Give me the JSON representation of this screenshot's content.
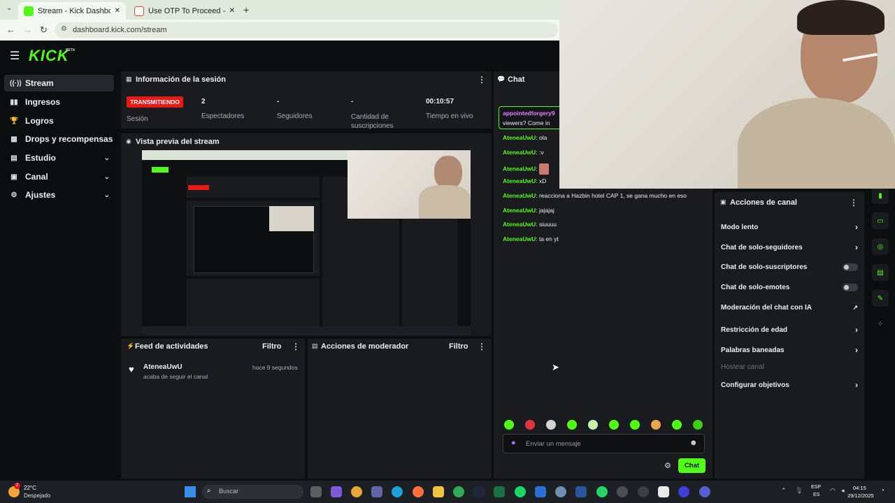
{
  "browser": {
    "tabs": [
      {
        "label": "Stream - Kick Dashboard",
        "active": true
      },
      {
        "label": "Use OTP To Proceed - elfacheer",
        "active": false
      }
    ],
    "url": "dashboard.kick.com/stream"
  },
  "brand": {
    "logo": "KICK",
    "badge": "BETA",
    "accent": "#53fc18"
  },
  "sidebar": {
    "items": [
      {
        "label": "Stream",
        "icon": "stream-icon",
        "active": true
      },
      {
        "label": "Ingresos",
        "icon": "revenue-icon"
      },
      {
        "label": "Logros",
        "icon": "trophy-icon"
      },
      {
        "label": "Drops y recompensas",
        "icon": "gift-icon"
      },
      {
        "label": "Estudio",
        "icon": "studio-icon",
        "expandable": true
      },
      {
        "label": "Canal",
        "icon": "channel-icon",
        "expandable": true
      },
      {
        "label": "Ajustes",
        "icon": "gear-icon",
        "expandable": true
      }
    ]
  },
  "session": {
    "title": "Información de la sesión",
    "status_badge": "TRANSMITIENDO",
    "status_label": "Sesión",
    "stats": [
      {
        "value": "2",
        "label": "Espectadores"
      },
      {
        "value": "-",
        "label": "Seguidores"
      },
      {
        "value": "-",
        "label": "Cantidad de suscripciones"
      },
      {
        "value": "00:10:57",
        "label": "Tiempo en vivo"
      }
    ]
  },
  "preview": {
    "title": "Vista previa del stream"
  },
  "activity": {
    "title": "Feed de actividades",
    "filter": "Filtro",
    "items": [
      {
        "user": "AteneaUwU",
        "text": "acaba de seguir el canal",
        "time": "hace 9 segundos"
      }
    ]
  },
  "moderator": {
    "title": "Acciones de moderador",
    "filter": "Filtro"
  },
  "chat": {
    "title": "Chat",
    "pinned": {
      "user": "appointedforgery9",
      "text": "viewers? Come in"
    },
    "messages": [
      {
        "user": "AteneaUwU",
        "text": "ola"
      },
      {
        "user": "AteneaUwU",
        "text": ":v"
      },
      {
        "user": "AteneaUwU",
        "text": ""
      },
      {
        "user": "AteneaUwU",
        "text": "xD"
      },
      {
        "user": "AteneaUwU",
        "text": "reacciona a Hazbin hotel CAP 1, se gana mucho en eso"
      },
      {
        "user": "AteneaUwU",
        "text": "jajajaj"
      },
      {
        "user": "AteneaUwU",
        "text": "siuuuu"
      },
      {
        "user": "AteneaUwU",
        "text": "ta en yt"
      }
    ],
    "input_placeholder": "Enviar un mensaje",
    "send_label": "Chat"
  },
  "channel_actions": {
    "title": "Acciones de canal",
    "items": [
      {
        "label": "Modo lento",
        "control": "arrow"
      },
      {
        "label": "Chat de solo-seguidores",
        "control": "arrow"
      },
      {
        "label": "Chat de solo-suscriptores",
        "control": "toggle",
        "on": false
      },
      {
        "label": "Chat de solo-emotes",
        "control": "toggle",
        "on": false
      },
      {
        "label": "Moderación del chat con IA",
        "control": "external"
      },
      {
        "label": "Restricción de edad",
        "control": "arrow"
      },
      {
        "label": "Palabras baneadas",
        "control": "arrow"
      },
      {
        "label": "Hostear canal",
        "control": "none",
        "disabled": true
      },
      {
        "label": "Configurar objetivos",
        "control": "arrow"
      }
    ]
  },
  "taskbar": {
    "weather_temp": "22°C",
    "weather_text": "Despejado",
    "weather_badge": "2",
    "search_placeholder": "Buscar",
    "lang_top": "ESP",
    "lang_bottom": "ES",
    "time": "04:15",
    "date": "29/12/2025"
  }
}
